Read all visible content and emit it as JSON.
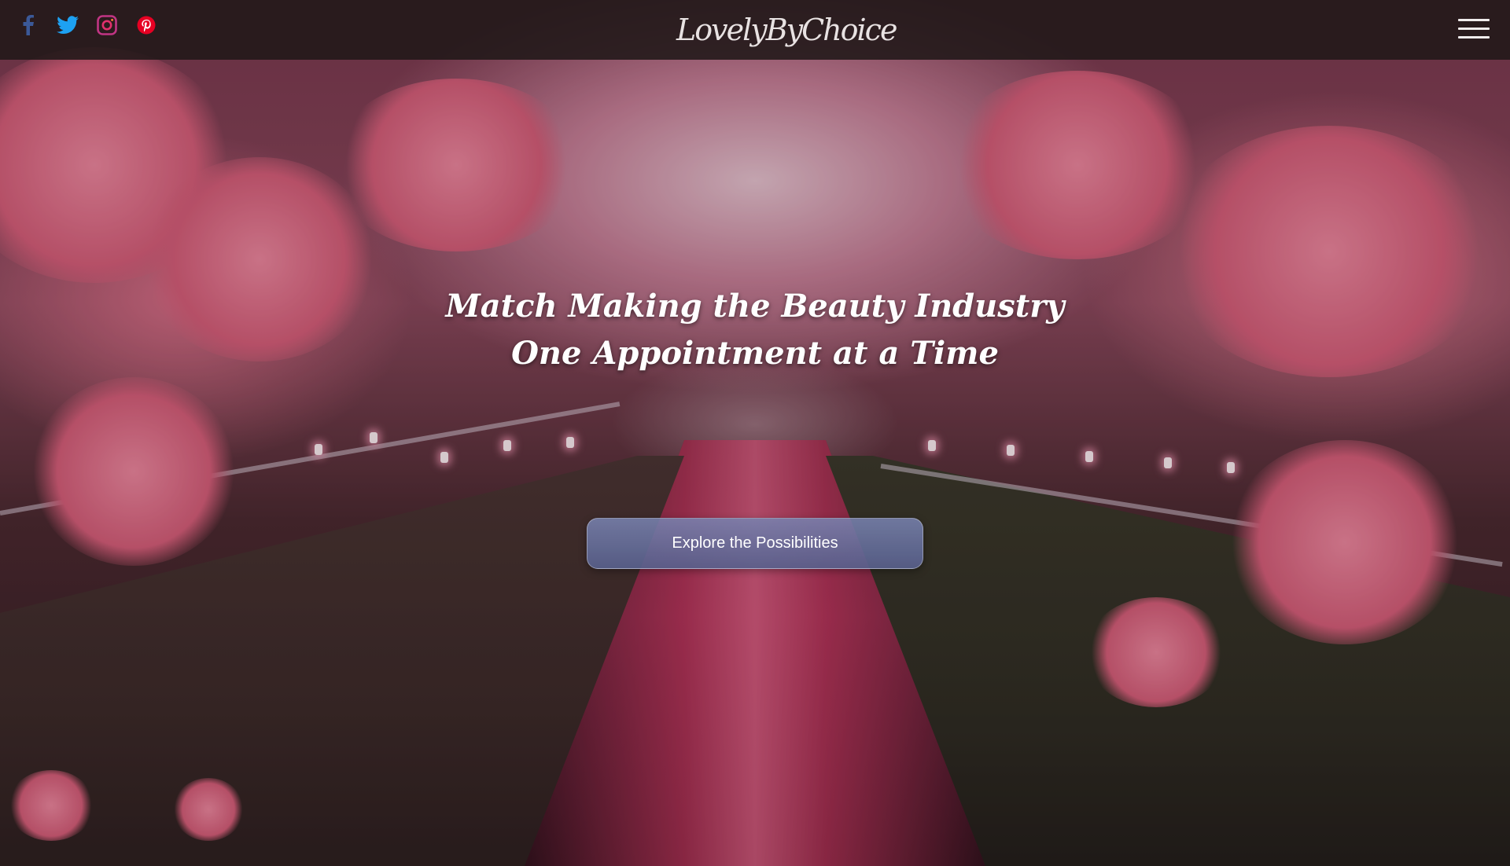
{
  "header": {
    "logo_text": "LovelyByChoice",
    "social": [
      {
        "name": "facebook",
        "icon": "facebook-icon",
        "color": "#3b5998"
      },
      {
        "name": "twitter",
        "icon": "twitter-icon",
        "color": "#1da1f2"
      },
      {
        "name": "instagram",
        "icon": "instagram-icon",
        "color": "#c13584"
      },
      {
        "name": "pinterest",
        "icon": "pinterest-icon",
        "color": "#e60023"
      }
    ],
    "menu_icon": "hamburger-icon"
  },
  "hero": {
    "headline_line1": "Match Making the Beauty Industry",
    "headline_line2": "One Appointment at a Time",
    "cta_label": "Explore the Possibilities",
    "cta_color": "#5d6694"
  }
}
